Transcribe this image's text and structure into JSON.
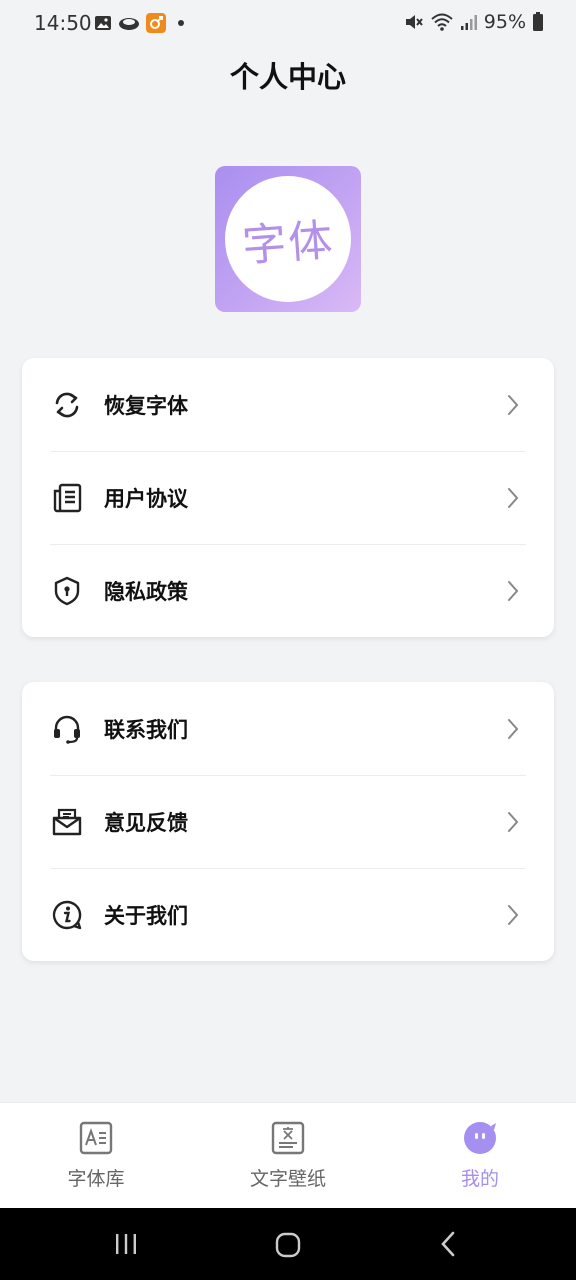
{
  "status_bar": {
    "time": "14:50",
    "battery": "95%",
    "icons": [
      "image-icon",
      "cloud-icon",
      "app-badge-icon",
      "dot-icon",
      "mute-icon",
      "wifi-icon",
      "signal-icon",
      "battery-icon"
    ]
  },
  "header": {
    "title": "个人中心"
  },
  "logo": {
    "text": "字体",
    "accent": "#a98ff0"
  },
  "menu_groups": [
    {
      "items": [
        {
          "label": "恢复字体",
          "icon": "refresh-icon"
        },
        {
          "label": "用户协议",
          "icon": "document-icon"
        },
        {
          "label": "隐私政策",
          "icon": "shield-icon"
        }
      ]
    },
    {
      "items": [
        {
          "label": "联系我们",
          "icon": "headset-icon"
        },
        {
          "label": "意见反馈",
          "icon": "mail-icon"
        },
        {
          "label": "关于我们",
          "icon": "info-icon"
        }
      ]
    }
  ],
  "tabs": [
    {
      "label": "字体库",
      "icon": "font-library-icon",
      "active": false
    },
    {
      "label": "文字壁纸",
      "icon": "wallpaper-icon",
      "active": false
    },
    {
      "label": "我的",
      "icon": "profile-icon",
      "active": true
    }
  ],
  "colors": {
    "active_tab": "#a58ff0",
    "background": "#f2f3f5"
  }
}
